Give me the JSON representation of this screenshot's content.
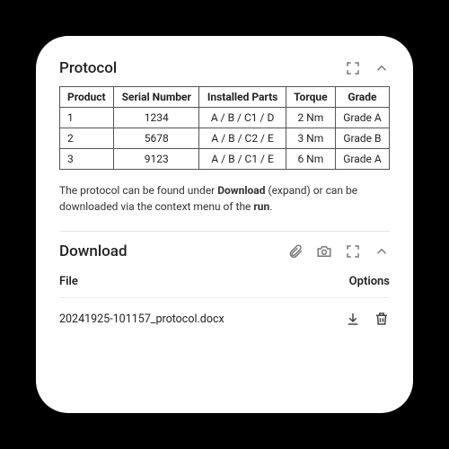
{
  "protocol": {
    "title": "Protocol",
    "columns": [
      "Product",
      "Serial Number",
      "Installed Parts",
      "Torque",
      "Grade"
    ],
    "rows": [
      {
        "product": "1",
        "serial": "1234",
        "parts": "A / B / C1 / D",
        "torque": "2 Nm",
        "grade": "Grade A"
      },
      {
        "product": "2",
        "serial": "5678",
        "parts": "A / B / C2 / E",
        "torque": "3 Nm",
        "grade": "Grade B"
      },
      {
        "product": "3",
        "serial": "9123",
        "parts": "A / B / C1 / E",
        "torque": "6 Nm",
        "grade": "Grade A"
      }
    ],
    "note_pre": "The protocol can be found under ",
    "note_b1": "Download",
    "note_mid": " (expand) or can be downloaded via the context menu of the ",
    "note_b2": "run",
    "note_post": "."
  },
  "download": {
    "title": "Download",
    "col_file": "File",
    "col_options": "Options",
    "files": [
      {
        "name": "20241925-101157_protocol.docx"
      }
    ]
  }
}
